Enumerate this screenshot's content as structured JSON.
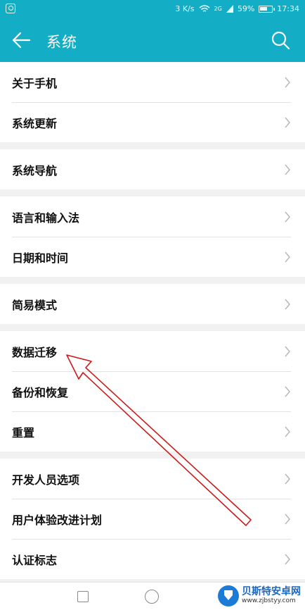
{
  "status_bar": {
    "network_speed": "3 K/s",
    "network_type": "2G",
    "battery": "59%",
    "time": "17:34"
  },
  "app_bar": {
    "title": "系统"
  },
  "groups": [
    [
      "关于手机",
      "系统更新"
    ],
    [
      "系统导航"
    ],
    [
      "语言和输入法",
      "日期和时间"
    ],
    [
      "简易模式"
    ],
    [
      "数据迁移",
      "备份和恢复",
      "重置"
    ],
    [
      "开发人员选项",
      "用户体验改进计划",
      "认证标志"
    ]
  ],
  "watermark": {
    "main": "贝斯特安卓网",
    "sub": "www.zjbstyy.com"
  },
  "colors": {
    "header": "#14adc6",
    "annotation_arrow": "#cc1a1a"
  }
}
